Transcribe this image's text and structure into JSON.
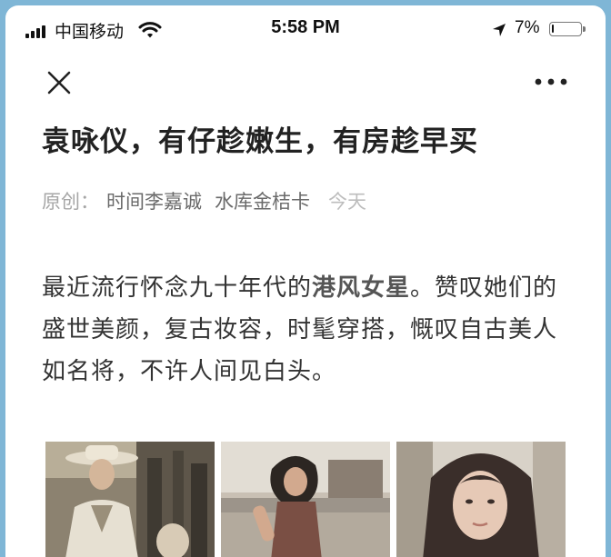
{
  "status_bar": {
    "carrier": "中国移动",
    "time": "5:58 PM",
    "battery_percent": "7%",
    "battery_level": 0.07,
    "icons": [
      "signal-icon",
      "wifi-icon",
      "location-arrow-icon",
      "battery-icon"
    ]
  },
  "nav": {
    "close_icon": "close-icon",
    "more_icon": "more-icon"
  },
  "article": {
    "title": "袁咏仪，有仔趁嫩生，有房趁早买",
    "meta": {
      "original_label": "原创：",
      "author": "时间李嘉诚",
      "account": "水库金桔卡",
      "date": "今天"
    },
    "paragraph": {
      "before": "最近流行怀念九十年代的",
      "highlight": "港风女星",
      "after": "。赞叹她们的盛世美颜，复古妆容，时髦穿搭，慨叹自古美人如名将，不许人间见白头。"
    },
    "images": [
      {
        "kind": "photo",
        "subject": "woman in white hat and jacket"
      },
      {
        "kind": "photo",
        "subject": "woman seated on rooftop"
      },
      {
        "kind": "photo",
        "subject": "woman with long wavy hair"
      }
    ]
  },
  "colors": {
    "frame": "#7fb6d6",
    "title": "#222222",
    "meta": "#a6a6a6",
    "body": "#333333"
  }
}
